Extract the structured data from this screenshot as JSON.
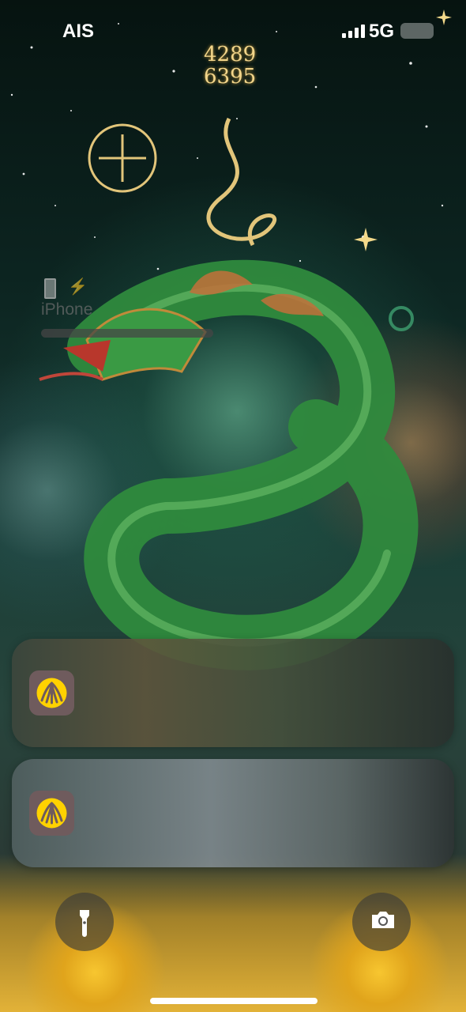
{
  "status_bar": {
    "carrier": "AIS",
    "network": "5G",
    "signal_bars": 4
  },
  "wallpaper": {
    "top_numbers_line1": "4289",
    "top_numbers_line2": "6395"
  },
  "battery_widget": {
    "device_label": "iPhone",
    "icons": [
      "battery-icon",
      "lightning-bolt-icon"
    ]
  },
  "notifications": [
    {
      "app_icon": "krungsri-app-icon"
    },
    {
      "app_icon": "krungsri-app-icon"
    }
  ],
  "quick_actions": {
    "left_icon": "flashlight-icon",
    "right_icon": "camera-icon"
  },
  "colors": {
    "app_icon_bg": "#6f5b5d",
    "app_icon_fg": "#ffd200",
    "status_text": "#ffffff"
  }
}
